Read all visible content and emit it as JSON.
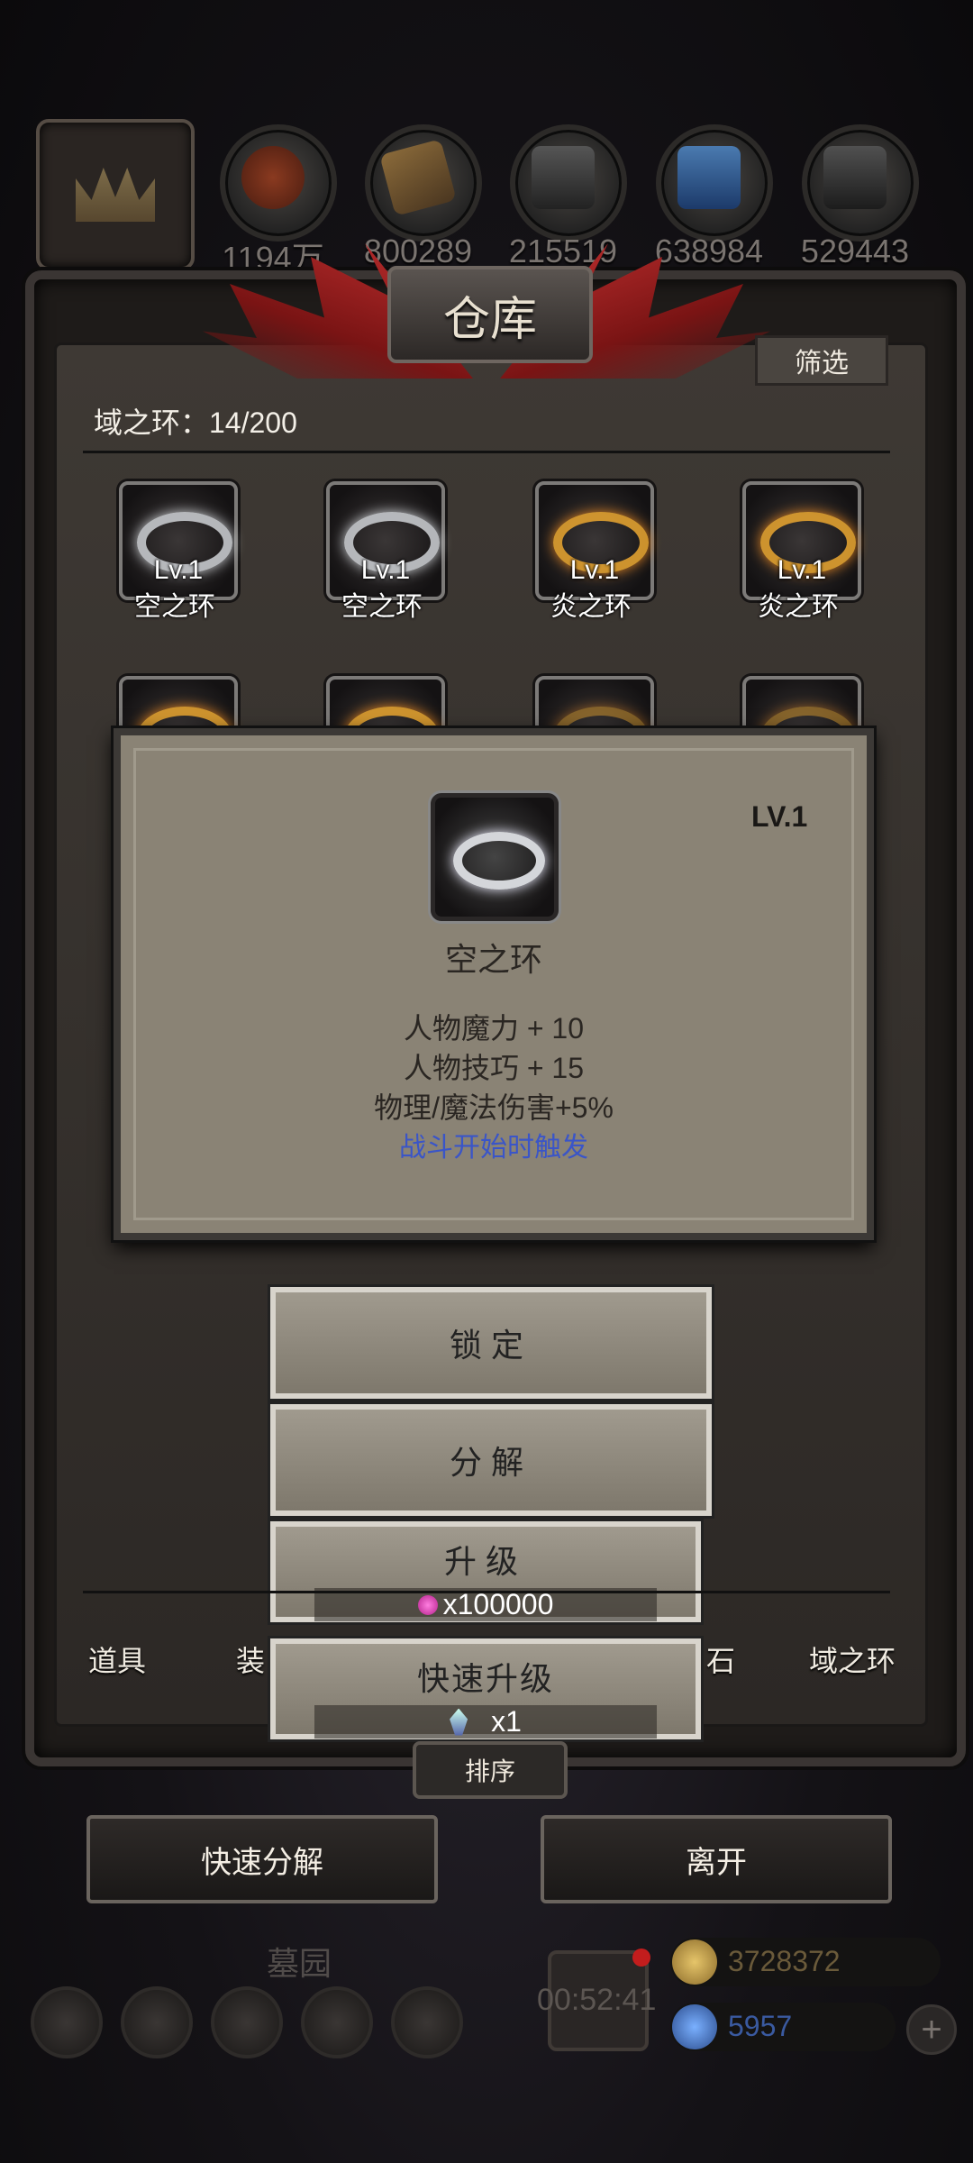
{
  "resources": [
    {
      "value": "1194万",
      "icon": "meat-icon"
    },
    {
      "value": "800289",
      "icon": "wood-icon"
    },
    {
      "value": "215519",
      "icon": "stone-icon"
    },
    {
      "value": "638984",
      "icon": "crystal-icon"
    },
    {
      "value": "529443",
      "icon": "iron-icon"
    }
  ],
  "warehouse": {
    "title": "仓库",
    "filter_label": "筛选",
    "count_label": "域之环：14/200"
  },
  "items": [
    {
      "level": "Lv.1",
      "name": "空之环",
      "type": "air"
    },
    {
      "level": "Lv.1",
      "name": "空之环",
      "type": "air"
    },
    {
      "level": "Lv.1",
      "name": "炎之环",
      "type": "fire"
    },
    {
      "level": "Lv.1",
      "name": "炎之环",
      "type": "fire"
    }
  ],
  "detail": {
    "level": "LV.1",
    "name": "空之环",
    "stats": [
      "人物魔力 + 10",
      "人物技巧 + 15",
      "物理/魔法伤害+5%"
    ],
    "trigger": "战斗开始时触发"
  },
  "actions": {
    "lock": "锁定",
    "decompose": "分解",
    "upgrade": "升级",
    "upgrade_cost": "x100000",
    "quick_upgrade": "快速升级",
    "quick_upgrade_cost": "x1"
  },
  "tabs": [
    "道具",
    "装",
    "石",
    "域之环"
  ],
  "sort_label": "排序",
  "quick_decompose": "快速分解",
  "leave": "离开",
  "bottom": {
    "label": "墓园",
    "timer": "00:52:41",
    "gold": "3728372",
    "gems": "5957"
  },
  "colors": {
    "accent_red": "#c43131",
    "popup_bg": "#8a8375",
    "trigger_blue": "#3a55c8"
  }
}
